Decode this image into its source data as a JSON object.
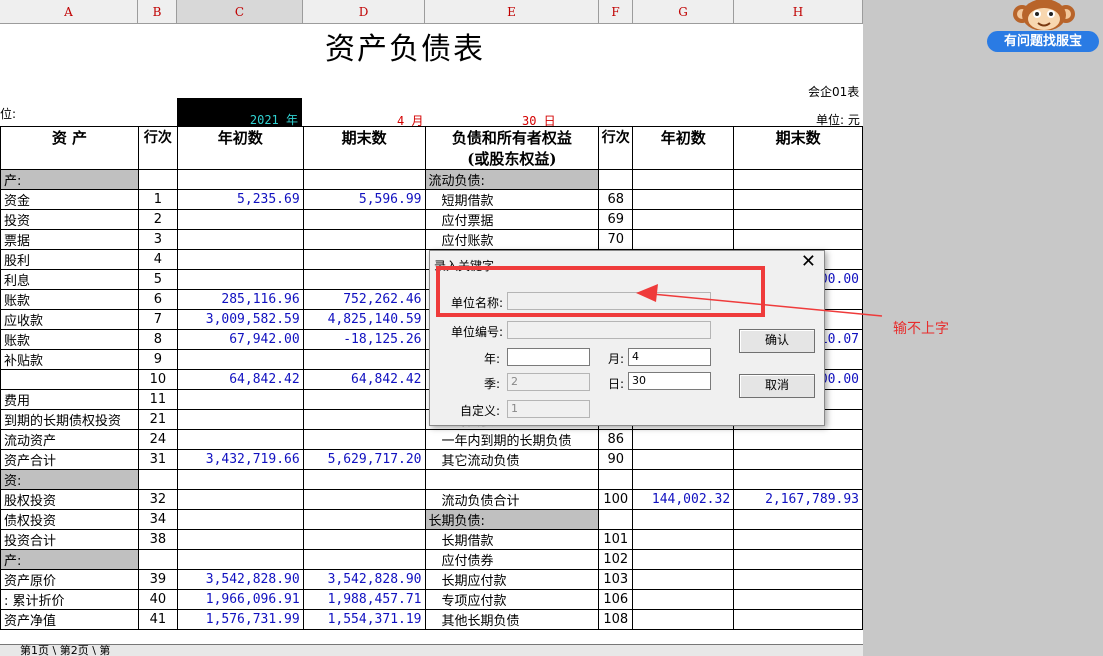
{
  "columns": [
    "A",
    "B",
    "C",
    "D",
    "E",
    "F",
    "G",
    "H"
  ],
  "title": "资产负债表",
  "form_code": "会企01表",
  "unit_label": "位:",
  "year_text": "2021 年",
  "month_text": "4 月",
  "day_text": "30 日",
  "currency_unit": "单位: 元",
  "headers": {
    "asset": "资 产",
    "line_no": "行次",
    "begin": "年初数",
    "end": "期末数",
    "liab_line1": "负债和所有者权益",
    "liab_line2": "(或股东权益)",
    "line_no2": "行次",
    "begin2": "年初数",
    "end2": "期末数"
  },
  "rows": [
    {
      "a": "产:",
      "b": "",
      "c": "",
      "d": "",
      "e": "流动负债:",
      "f": "",
      "g": "",
      "h": "",
      "ga": true,
      "ge": true
    },
    {
      "a": "资金",
      "b": "1",
      "c": "5,235.69",
      "d": "5,596.99",
      "e": "短期借款",
      "f": "68",
      "g": "",
      "h": ""
    },
    {
      "a": "投资",
      "b": "2",
      "c": "",
      "d": "",
      "e": "应付票据",
      "f": "69",
      "g": "",
      "h": ""
    },
    {
      "a": "票据",
      "b": "3",
      "c": "",
      "d": "",
      "e": "应付账款",
      "f": "70",
      "g": "",
      "h": ""
    },
    {
      "a": "股利",
      "b": "4",
      "c": "",
      "d": "",
      "e": "",
      "f": "",
      "g": "",
      "h": ""
    },
    {
      "a": "利息",
      "b": "5",
      "c": "",
      "d": "",
      "e": "",
      "f": "",
      "g": "",
      "h": "00.00"
    },
    {
      "a": "账款",
      "b": "6",
      "c": "285,116.96",
      "d": "752,262.46",
      "e": "",
      "f": "",
      "g": "",
      "h": ""
    },
    {
      "a": "应收款",
      "b": "7",
      "c": "3,009,582.59",
      "d": "4,825,140.59",
      "e": "",
      "f": "",
      "g": "",
      "h": ""
    },
    {
      "a": "账款",
      "b": "8",
      "c": "67,942.00",
      "d": "-18,125.26",
      "e": "",
      "f": "",
      "g": "",
      "h": "10.07"
    },
    {
      "a": "补贴款",
      "b": "9",
      "c": "",
      "d": "",
      "e": "",
      "f": "",
      "g": "",
      "h": ""
    },
    {
      "a": "",
      "b": "10",
      "c": "64,842.42",
      "d": "64,842.42",
      "e": "",
      "f": "",
      "g": "",
      "h": "00.00"
    },
    {
      "a": "费用",
      "b": "11",
      "c": "",
      "d": "",
      "e": "",
      "f": "",
      "g": "",
      "h": ""
    },
    {
      "a": "到期的长期债权投资",
      "b": "21",
      "c": "",
      "d": "",
      "e": "预计负债",
      "f": "83",
      "g": "",
      "h": ""
    },
    {
      "a": "流动资产",
      "b": "24",
      "c": "",
      "d": "",
      "e": "一年内到期的长期负债",
      "f": "86",
      "g": "",
      "h": ""
    },
    {
      "a": "资产合计",
      "b": "31",
      "c": "3,432,719.66",
      "d": "5,629,717.20",
      "e": "其它流动负债",
      "f": "90",
      "g": "",
      "h": ""
    },
    {
      "a": "资:",
      "b": "",
      "c": "",
      "d": "",
      "e": "",
      "f": "",
      "g": "",
      "h": "",
      "ga": true
    },
    {
      "a": "股权投资",
      "b": "32",
      "c": "",
      "d": "",
      "e": "流动负债合计",
      "f": "100",
      "g": "144,002.32",
      "h": "2,167,789.93"
    },
    {
      "a": "债权投资",
      "b": "34",
      "c": "",
      "d": "",
      "e": "长期负债:",
      "f": "",
      "g": "",
      "h": "",
      "ge": true
    },
    {
      "a": "投资合计",
      "b": "38",
      "c": "",
      "d": "",
      "e": "长期借款",
      "f": "101",
      "g": "",
      "h": ""
    },
    {
      "a": "产:",
      "b": "",
      "c": "",
      "d": "",
      "e": "应付债券",
      "f": "102",
      "g": "",
      "h": "",
      "ga": true
    },
    {
      "a": "资产原价",
      "b": "39",
      "c": "3,542,828.90",
      "d": "3,542,828.90",
      "e": "长期应付款",
      "f": "103",
      "g": "",
      "h": ""
    },
    {
      "a": ": 累计折价",
      "b": "40",
      "c": "1,966,096.91",
      "d": "1,988,457.71",
      "e": "专项应付款",
      "f": "106",
      "g": "",
      "h": ""
    },
    {
      "a": "资产净值",
      "b": "41",
      "c": "1,576,731.99",
      "d": "1,554,371.19",
      "e": "其他长期负债",
      "f": "108",
      "g": "",
      "h": ""
    }
  ],
  "sheet_tabs": "第1页 \\ 第2页 \\ 第",
  "help_button": "有问题找服宝",
  "dialog": {
    "title": "录入关键字",
    "close": "✕",
    "unit_name_label": "单位名称:",
    "unit_name_value": "",
    "unit_code_label": "单位编号:",
    "unit_code_value": "",
    "year_label": "年:",
    "year_value": "",
    "month_label": "月:",
    "month_value": "4",
    "season_label": "季:",
    "season_value": "2",
    "day_label": "日:",
    "day_value": "30",
    "custom_label": "自定义:",
    "custom_value": "1",
    "ok": "确认",
    "cancel": "取消"
  },
  "annotation_note": "输不上字",
  "colors": {
    "annotation": "#ef3b3b",
    "help_button": "#2a7be4",
    "numbers": "#1010c0"
  }
}
